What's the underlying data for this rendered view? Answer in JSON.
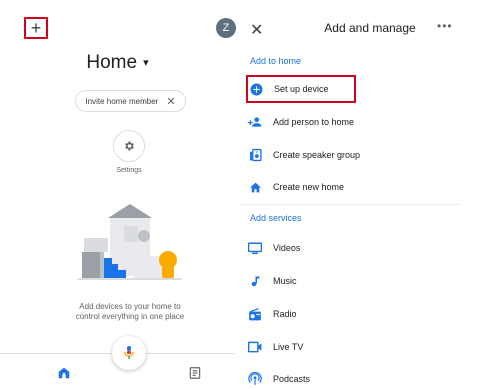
{
  "left": {
    "add_icon": "+",
    "avatar_initial": "Z",
    "home_title": "Home",
    "home_caret": "▾",
    "invite_chip_label": "Invite home member",
    "invite_chip_close": "✕",
    "settings_label": "Settings",
    "empty_state_text": "Add devices to your home to control everything in one place",
    "nav": [
      "home-icon",
      "feed-icon"
    ]
  },
  "right": {
    "header_title": "Add and manage",
    "close_icon": "✕",
    "more_icon": "•••",
    "sections": [
      {
        "title": "Add to home",
        "items": [
          {
            "label": "Set up device",
            "icon": "plus-circle-icon"
          },
          {
            "label": "Add person to home",
            "icon": "add-person-icon"
          },
          {
            "label": "Create speaker group",
            "icon": "speaker-group-icon"
          },
          {
            "label": "Create new home",
            "icon": "home-icon"
          }
        ]
      },
      {
        "title": "Add services",
        "items": [
          {
            "label": "Videos",
            "icon": "tv-icon"
          },
          {
            "label": "Music",
            "icon": "music-note-icon"
          },
          {
            "label": "Radio",
            "icon": "radio-icon"
          },
          {
            "label": "Live TV",
            "icon": "live-tv-icon"
          },
          {
            "label": "Podcasts",
            "icon": "podcast-icon"
          }
        ]
      }
    ]
  },
  "colors": {
    "accent_blue": "#1a73e8",
    "highlight_red": "#d0021b",
    "mic_yellow": "#f9ab00",
    "mic_red": "#ea4335"
  }
}
